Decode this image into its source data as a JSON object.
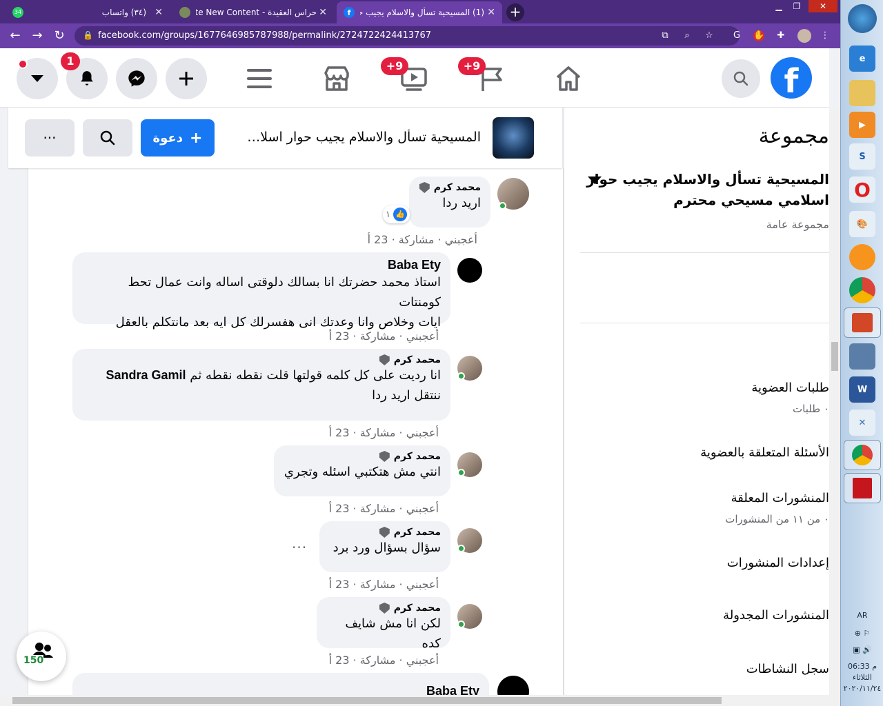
{
  "browser": {
    "tabs": [
      {
        "label": "(٣٤) واتساب",
        "badge": "34"
      },
      {
        "label": "حراس العقيدة - Create New Content"
      },
      {
        "label": "(1) المسيحية تسأل والاسلام يجيب حوار اسلامي"
      }
    ],
    "new_tab": "+",
    "url": "facebook.com/groups/1677646985787988/permalink/2724722424413767"
  },
  "fb_header": {
    "notifications_badge": "1",
    "watch_badge": "+9",
    "pages_badge": "+9",
    "logo": "f"
  },
  "group_bar": {
    "more_label": "···",
    "invite_label": "دعوة",
    "name": "المسيحية تسأل والاسلام يجيب حوار اسلامي مسيحي محترم"
  },
  "comments": [
    {
      "author": "محمد كرم",
      "text": "اريد ردا",
      "meta": "أعجبني · مشاركة · 23 أ",
      "reaction_count": "١"
    },
    {
      "author": "Baba Ety",
      "text_lines": [
        "استاذ محمد حضرتك انا بسالك دلوقتى اساله وانت عمال تحط كومنتات",
        "ايات وخلاص وانا وعدتك انى هفسرلك كل ايه بعد مانتكلم بالعقل"
      ],
      "meta": "أعجبني · مشاركة · 23 أ"
    },
    {
      "author": "محمد كرم",
      "tag": "Sandra Gamil",
      "text_line1": "انا رديت على كل كلمه قولتها قلت نقطه نقطه ثم",
      "text_line2": "ننتقل اريد ردا",
      "meta": "أعجبني · مشاركة · 23 أ"
    },
    {
      "author": "محمد كرم",
      "text": "انتي مش هتكتبي اسئله وتجري",
      "meta": "أعجبني · مشاركة · 23 أ"
    },
    {
      "author": "محمد كرم",
      "text": "سؤال بسؤال ورد برد",
      "meta": "أعجبني · مشاركة · 23 أ"
    },
    {
      "author": "محمد كرم",
      "text": "لكن انا مش شايف كده",
      "meta": "أعجبني · مشاركة · 23 أ"
    },
    {
      "author": "Baba Ety"
    }
  ],
  "sidebar": {
    "title": "مجموعة",
    "group_name_line1": "المسيحية تسأل والاسلام يجيب حوار",
    "group_name_line2": "اسلامي مسيحي محترم",
    "privacy": "مجموعة عامة",
    "membership": "طلبات العضوية",
    "membership_sub": "٠ طلبات",
    "pending_membership": "الأسئلة المتعلقة بالعضوية",
    "pending_posts": "المنشورات المعلقة",
    "pending_posts_sub": "٠ من ١١ من المنشورات",
    "post_settings": "إعدادات المنشورات",
    "scheduled": "المنشورات المجدولة",
    "activity": "سجل النشاطات"
  },
  "people_fab": {
    "count": "150"
  },
  "taskbar": {
    "lang": "AR",
    "time": "06:33 م",
    "day": "الثلاثاء",
    "date": "٢٠٢٠/١١/٢٤"
  }
}
